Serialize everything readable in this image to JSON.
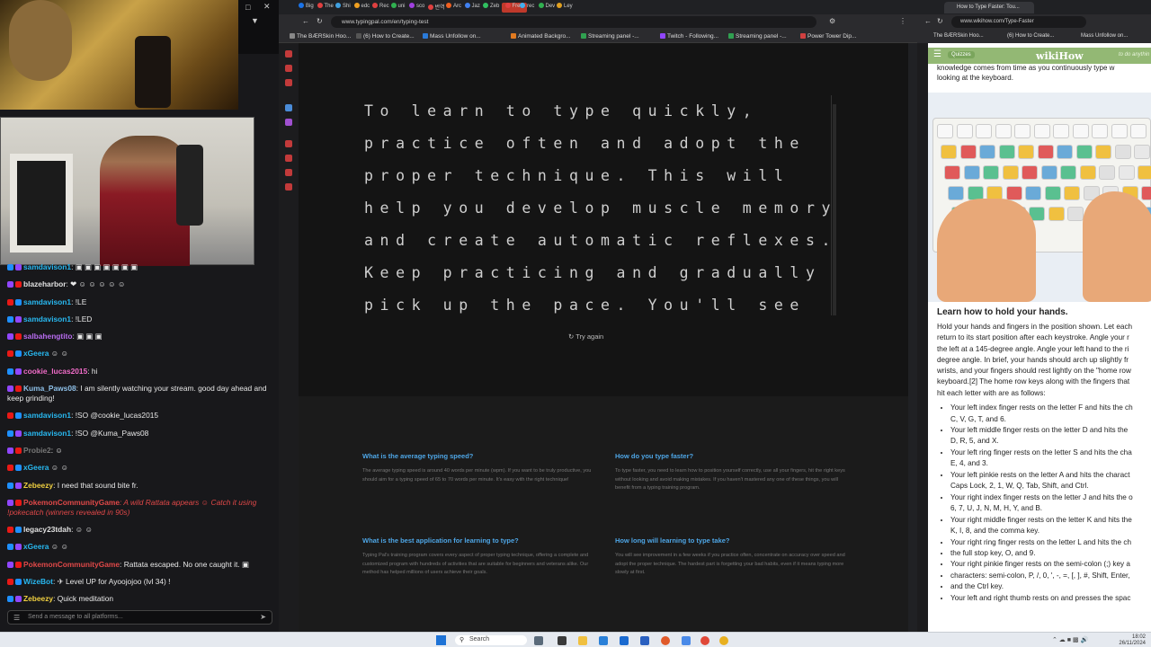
{
  "chat": {
    "messages": [
      {
        "user": "samdavison1",
        "color": "#28b8f0",
        "text": ": ▣ ▣ ▣ ▣ ▣ ▣ ▣",
        "style": "txt"
      },
      {
        "user": "blazeharbor",
        "color": "#e0e0e0",
        "text": ": ❤ ☺ ☺ ☺ ☺ ☺",
        "style": "txt"
      },
      {
        "user": "samdavison1",
        "color": "#28b8f0",
        "text": ": !LE",
        "style": "txt"
      },
      {
        "user": "samdavison1",
        "color": "#28b8f0",
        "text": ": !LED",
        "style": "txt"
      },
      {
        "user": "salbahengtito",
        "color": "#b86cf0",
        "text": ": ▣ ▣ ▣",
        "style": "txt"
      },
      {
        "user": "xGeera",
        "color": "#28b8f0",
        "text": " ☺ ☺",
        "style": "txt"
      },
      {
        "user": "cookie_lucas2015",
        "color": "#f06cc8",
        "text": ": hi",
        "style": "txt"
      },
      {
        "user": "Kuma_Paws08",
        "color": "#8ec0e8",
        "text": ": I am silently watching your stream. good day ahead and keep grinding!",
        "style": "txt",
        "wrap": true
      },
      {
        "user": "samdavison1",
        "color": "#28b8f0",
        "text": ": !SO @cookie_lucas2015",
        "style": "txt"
      },
      {
        "user": "samdavison1",
        "color": "#28b8f0",
        "text": ": !SO @Kuma_Paws08",
        "style": "txt"
      },
      {
        "user": "Probie2",
        "color": "#777777",
        "text": ": ☺",
        "style": "txt"
      },
      {
        "user": "xGeera",
        "color": "#28b8f0",
        "text": " ☺ ☺",
        "style": "txt"
      },
      {
        "user": "Zebeezy",
        "color": "#f0d040",
        "text": ": I need that sound bite fr.",
        "style": "txt"
      },
      {
        "user": "PokemonCommunityGame",
        "color": "#e04848",
        "text": ": A wild Rattata appears ☺ Catch it using !pokecatch (winners revealed in 90s)",
        "style": "sys",
        "wrap": true
      },
      {
        "user": "legacy23tdah",
        "color": "#e0e0e0",
        "text": ": ☺ ☺",
        "style": "txt"
      },
      {
        "user": "xGeera",
        "color": "#28b8f0",
        "text": " ☺ ☺",
        "style": "txt"
      },
      {
        "user": "PokemonCommunityGame",
        "color": "#e04848",
        "text": ": Rattata escaped. No one caught it. ▣",
        "style": "txt"
      },
      {
        "user": "WizeBot",
        "color": "#28b8f0",
        "text": ": ✈ Level UP for Ayoojojoo (lvl 34) !",
        "style": "txt"
      },
      {
        "user": "Zebeezy",
        "color": "#f0d040",
        "text": ": Quick meditation",
        "style": "txt"
      }
    ],
    "input_placeholder": "Send a message to all platforms..."
  },
  "mid_browser": {
    "tabs": [
      "Big",
      "The",
      "Shi",
      "edc",
      "Rec",
      "uni",
      "sco",
      "번역",
      "Arc",
      "Jaz",
      "Zeb",
      "Free",
      "rec",
      "Dev",
      "Ley"
    ],
    "active_tab": "Free",
    "url": "www.typingpal.com/en/typing-test",
    "bookmarks": [
      "The BÆRSkin Hoo...",
      "(6) How to Create...",
      "Mass Unfollow on...",
      "Animated Backgro...",
      "Streaming panel -...",
      "Twitch - Following...",
      "Streaming panel -...",
      "Power Tower Dip..."
    ]
  },
  "typing_test": {
    "lines": [
      "To learn to type quickly,",
      "practice often and adopt the",
      "proper technique. This will",
      "help you develop muscle memory",
      "and create automatic reflexes.",
      "Keep practicing and gradually",
      "pick up the pace. You'll see"
    ],
    "try_again": "Try again"
  },
  "faq": [
    {
      "q": "What is the average typing speed?",
      "a": "The average typing speed is around 40 words per minute (wpm). If you want to be truly productive, you should aim for a typing speed of 65 to 70 words per minute. It's easy with the right technique!"
    },
    {
      "q": "How do you type faster?",
      "a": "To type faster, you need to learn how to position yourself correctly, use all your fingers, hit the right keys without looking and avoid making mistakes. If you haven't mastered any one of these things, you will benefit from a typing training program."
    },
    {
      "q": "What is the best application for learning to type?",
      "a": "Typing Pal's training program covers every aspect of proper typing technique, offering a complete and customized program with hundreds of activities that are suitable for beginners and veterans alike. Our method has helped millions of users achieve their goals."
    },
    {
      "q": "How long will learning to type take?",
      "a": "You will see improvement in a few weeks if you practice often, concentrate on accuracy over speed and adopt the proper technique. The hardest part is forgetting your bad habits, even if it means typing more slowly at first."
    }
  ],
  "right_browser": {
    "tab_title": "How to Type Faster: Tou...",
    "url": "www.wikihow.com/Type-Faster",
    "bookmarks": [
      "The BÆRSkin Hoo...",
      "(6) How to Create...",
      "Mass Unfollow on..."
    ],
    "logo": "wikiHow",
    "quizzes": "Quizzes",
    "todo": "to do anythin",
    "intro": [
      "knowledge comes from time as you continuously type w",
      "looking at the keyboard."
    ],
    "heading": "Learn how to hold your hands.",
    "paragraph": [
      "Hold your hands and fingers in the position shown. Let each",
      "return to its start position after each keystroke. Angle your r",
      "the left at a 145-degree angle. Angle your left hand to the ri",
      "degree angle. In brief, your hands should arch up slightly fr",
      "wrists, and your fingers should rest lightly on the \"home row",
      "keyboard.[2] The home row keys along with the fingers that",
      "hit each letter with are as follows:"
    ],
    "bullets": [
      "Your left index finger rests on the letter F and hits the ch",
      "C, V, G, T, and 6.",
      "Your left middle finger rests on the letter D and hits the",
      "D, R, 5, and X.",
      "Your left ring finger rests on the letter S and hits the cha",
      "E, 4, and 3.",
      "Your left pinkie rests on the letter A and hits the charact",
      "Caps Lock, 2, 1, W, Q, Tab, Shift, and Ctrl.",
      "Your right index finger rests on the letter J and hits the o",
      "6, 7, U, J, N, M, H, Y, and B.",
      "Your right middle finger rests on the letter K and hits the",
      "K, I, 8, and the comma key.",
      "Your right ring finger rests on the letter L and hits the ch",
      "the full stop key, O, and 9.",
      "Your right pinkie finger rests on the semi-colon (;) key a",
      "characters: semi-colon, P, /, 0, ', -, =, [, ], #, Shift, Enter,",
      "and the Ctrl key.",
      "Your left and right thumb rests on and presses the spac"
    ]
  },
  "taskbar": {
    "search": "Search",
    "time": "18:02",
    "date": "26/11/2024"
  }
}
